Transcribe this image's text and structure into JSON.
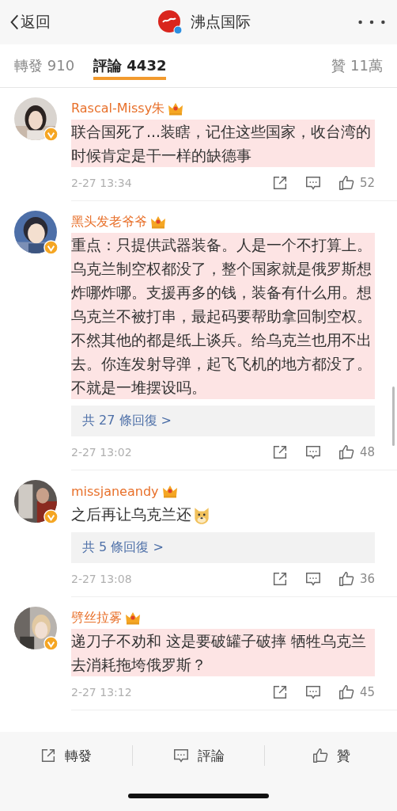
{
  "header": {
    "back_label": "返回",
    "title": "沸点国际"
  },
  "tabs": [
    {
      "label": "轉發 910",
      "selected": false
    },
    {
      "label": "評論 4432",
      "selected": true
    },
    {
      "label": "贊 11萬",
      "selected": false
    }
  ],
  "comments": [
    {
      "user": "Rascal-Missy朱",
      "text": "联合国死了...装瞎，记住这些国家，收台湾的时候肯定是干一样的缺德事",
      "highlighted": true,
      "emoji": false,
      "time": "2-27 13:34",
      "likes": "52"
    },
    {
      "user": "黑头发老爷爷",
      "text": "重点：只提供武器装备。人是一个不打算上。乌克兰制空权都没了，整个国家就是俄罗斯想炸哪炸哪。支援再多的钱，装备有什么用。想乌克兰不被打串，最起码要帮助拿回制空权。不然其他的都是纸上谈兵。给乌克兰也用不出去。你连发射导弹，起飞飞机的地方都没了。不就是一堆摆设吗。",
      "highlighted": true,
      "emoji": false,
      "replies": "共 27 條回復 >",
      "time": "2-27 13:02",
      "likes": "48"
    },
    {
      "user": "missjaneandy",
      "text": "之后再让乌克兰还",
      "highlighted": false,
      "emoji": true,
      "replies": "共 5 條回復 >",
      "time": "2-27 13:08",
      "likes": "36"
    },
    {
      "user": "劈丝拉雾",
      "text": "递刀子不劝和 这是要破罐子破摔 牺牲乌克兰去消耗拖垮俄罗斯？",
      "highlighted": true,
      "emoji": false,
      "time": "2-27 13:12",
      "likes": "45"
    }
  ],
  "actions": [
    {
      "kind": "repost",
      "label": "轉發"
    },
    {
      "kind": "comment",
      "label": "評論"
    },
    {
      "kind": "like",
      "label": "贊"
    }
  ]
}
